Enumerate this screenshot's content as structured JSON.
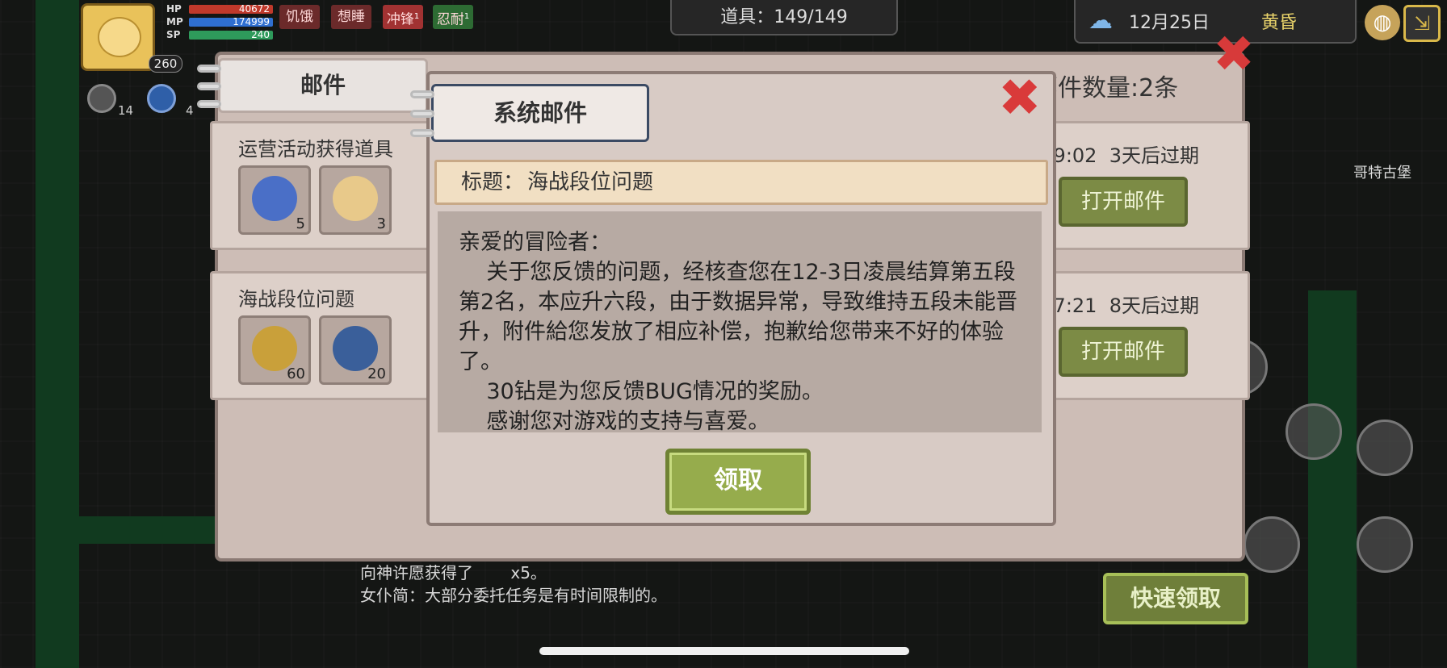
{
  "hud": {
    "level": "260",
    "hp_label": "HP",
    "hp_value": "40672",
    "mp_label": "MP",
    "mp_value": "174999",
    "sp_label": "SP",
    "sp_value": "240",
    "status_tags": [
      {
        "label": "饥饿",
        "color": "#8a2a2a"
      },
      {
        "label": "想睡",
        "color": "#8a2a2a"
      },
      {
        "label": "冲锋",
        "color": "#b83a3a",
        "badge": "1"
      },
      {
        "label": "忍耐",
        "color": "#3a7a3a",
        "badge": "1"
      }
    ],
    "gear_count": "14",
    "gem_count": "4"
  },
  "items_counter": "道具：149/149",
  "weather": {
    "date": "12月25日",
    "time": "黄昏",
    "icon": "cloud-rain-icon"
  },
  "map_label": "哥特古堡",
  "quick_claim_label": "快速领取",
  "chat": {
    "line1": "向神许愿获得了 ",
    "line1_suffix": "x5。",
    "line2": "女仆简：大部分委托任务是有时间限制的。"
  },
  "mail_panel": {
    "tab_label": "邮件",
    "mail_count": "邮件数量:2条",
    "cards": [
      {
        "title": "运营活动获得道具",
        "time": "9:02",
        "expire": "3天后过期",
        "open_label": "打开邮件",
        "slots": [
          {
            "icon": "scroll-icon",
            "count": "5",
            "color": "#4a6fc7"
          },
          {
            "icon": "potion-bottle-icon",
            "count": "3",
            "color": "#e8c98a"
          }
        ]
      },
      {
        "title": "海战段位问题",
        "time": "17:21",
        "expire": "8天后过期",
        "open_label": "打开邮件",
        "slots": [
          {
            "icon": "gold-coin-icon",
            "count": "60",
            "color": "#c9a03a"
          },
          {
            "icon": "horn-icon",
            "count": "20",
            "color": "#3a5f9a"
          }
        ]
      }
    ]
  },
  "popup": {
    "tab_label": "系统邮件",
    "title_prefix": "标题：",
    "title": "海战段位问题",
    "body": [
      "亲爱的冒险者：",
      "    关于您反馈的问题，经核查您在12-3日凌晨结算第五段第2名，本应升六段，由于数据异常，导致维持五段未能晋升，附件給您发放了相应补偿，抱歉给您带来不好的体验了。",
      "    30钻是为您反馈BUG情况的奖励。",
      "    感谢您对游戏的支持与喜爱。"
    ],
    "claim_label": "领取"
  },
  "colors": {
    "hp_bar": "#c0392b",
    "mp_bar": "#2f6fd1",
    "sp_bar": "#2e9a5b",
    "close_red": "#d93a3a",
    "claim_green": "#96ac4c"
  }
}
